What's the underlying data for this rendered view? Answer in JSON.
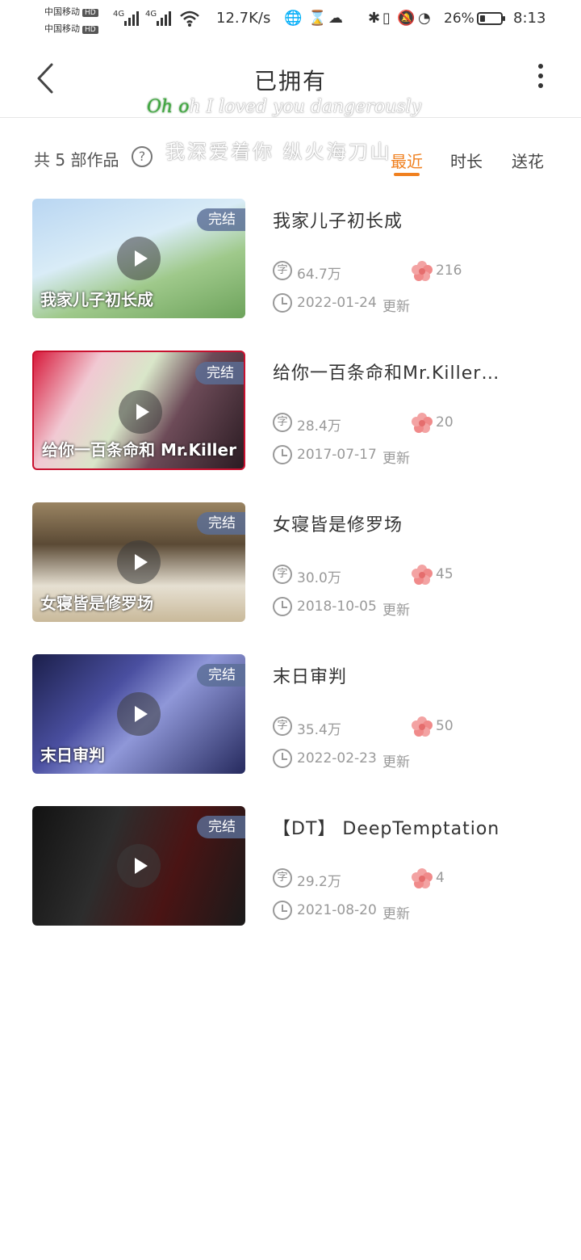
{
  "status_bar": {
    "carrier1": "中国移动",
    "carrier2": "中国移动",
    "hd": "HD",
    "network1": "4G",
    "network2": "4G",
    "speed": "12.7K/s",
    "battery_percent": "26%",
    "battery_level": 0.26,
    "time": "8:13"
  },
  "header": {
    "title": "已拥有"
  },
  "lyrics": {
    "line1_sung": "Oh o",
    "line1_rest": "h I loved you dangerously",
    "line2": "我深爱着你 纵火海刀山"
  },
  "filter": {
    "count_label": "共 5 部作品",
    "help": "?",
    "sort_tabs": [
      {
        "label": "最近",
        "active": true
      },
      {
        "label": "时长",
        "active": false
      },
      {
        "label": "送花",
        "active": false
      }
    ]
  },
  "items": [
    {
      "title": "我家儿子初长成",
      "badge": "完结",
      "word_icon": "字",
      "words": "64.7万",
      "flowers": "216",
      "date": "2022-01-24",
      "update": "更新",
      "caption": "我家儿子初长成"
    },
    {
      "title": "给你一百条命和Mr.Killer…",
      "badge": "完结",
      "word_icon": "字",
      "words": "28.4万",
      "flowers": "20",
      "date": "2017-07-17",
      "update": "更新",
      "caption": "给你一百条命和 Mr.Killer"
    },
    {
      "title": "女寝皆是修罗场",
      "badge": "完结",
      "word_icon": "字",
      "words": "30.0万",
      "flowers": "45",
      "date": "2018-10-05",
      "update": "更新",
      "caption": "女寝皆是修罗场"
    },
    {
      "title": "末日审判",
      "badge": "完结",
      "word_icon": "字",
      "words": "35.4万",
      "flowers": "50",
      "date": "2022-02-23",
      "update": "更新",
      "caption": "末日审判"
    },
    {
      "title": "【DT】 DeepTemptation",
      "badge": "完结",
      "word_icon": "字",
      "words": "29.2万",
      "flowers": "4",
      "date": "2021-08-20",
      "update": "更新",
      "caption": ""
    }
  ],
  "colors": {
    "accent": "#f0801f",
    "badge_bg": "#5a6e96",
    "flower": "#f08a8a",
    "muted": "#999999"
  },
  "icons": [
    "back-arrow-icon",
    "more-vertical-icon",
    "help-circle-icon",
    "play-icon",
    "word-count-icon",
    "flower-icon",
    "clock-icon"
  ]
}
